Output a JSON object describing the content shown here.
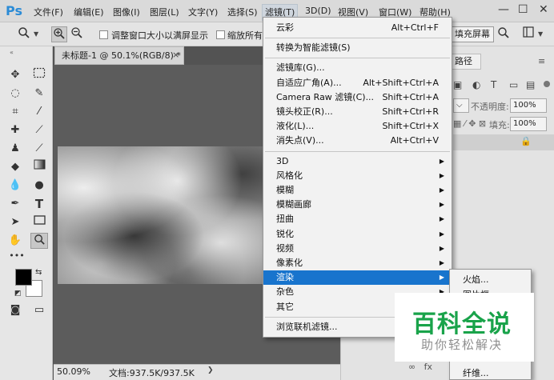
{
  "app": {
    "logo": "Ps"
  },
  "menubar": {
    "items": [
      "文件(F)",
      "编辑(E)",
      "图像(I)",
      "图层(L)",
      "文字(Y)",
      "选择(S)",
      "滤镜(T)",
      "3D(D)",
      "视图(V)",
      "窗口(W)",
      "帮助(H)"
    ],
    "active_index": 6,
    "window_controls": [
      "—",
      "☐",
      "✕"
    ]
  },
  "options": {
    "resize_windows_label": "调整窗口大小以满屏显示",
    "zoom_all_label": "缩放所有",
    "fill_screen_button": "填充屏幕"
  },
  "document": {
    "tab_title": "未标题-1 @ 50.1%(RGB/8) *",
    "close_glyph": "×",
    "zoom_level": "50.09%",
    "doc_size": "文档:937.5K/937.5K"
  },
  "right_panel": {
    "tab_path": "路径",
    "opacity_label": "不透明度:",
    "opacity_value": "100%",
    "fill_label": "填充:",
    "fill_value": "100%"
  },
  "filter_menu": {
    "items": [
      {
        "label": "云彩",
        "shortcut": "Alt+Ctrl+F"
      },
      {
        "sep": true
      },
      {
        "label": "转换为智能滤镜(S)"
      },
      {
        "sep": true
      },
      {
        "label": "滤镜库(G)..."
      },
      {
        "label": "自适应广角(A)...",
        "shortcut": "Alt+Shift+Ctrl+A"
      },
      {
        "label": "Camera Raw 滤镜(C)...",
        "shortcut": "Shift+Ctrl+A"
      },
      {
        "label": "镜头校正(R)...",
        "shortcut": "Shift+Ctrl+R"
      },
      {
        "label": "液化(L)...",
        "shortcut": "Shift+Ctrl+X"
      },
      {
        "label": "消失点(V)...",
        "shortcut": "Alt+Ctrl+V"
      },
      {
        "sep": true
      },
      {
        "label": "3D",
        "submenu": true
      },
      {
        "label": "风格化",
        "submenu": true
      },
      {
        "label": "模糊",
        "submenu": true
      },
      {
        "label": "模糊画廊",
        "submenu": true
      },
      {
        "label": "扭曲",
        "submenu": true
      },
      {
        "label": "锐化",
        "submenu": true
      },
      {
        "label": "视频",
        "submenu": true
      },
      {
        "label": "像素化",
        "submenu": true
      },
      {
        "label": "渲染",
        "submenu": true,
        "highlighted": true
      },
      {
        "label": "杂色",
        "submenu": true
      },
      {
        "label": "其它",
        "submenu": true
      },
      {
        "sep": true
      },
      {
        "label": "浏览联机滤镜..."
      }
    ]
  },
  "render_submenu": {
    "items": [
      "火焰...",
      "图片框...",
      "纤维..."
    ]
  },
  "watermark": {
    "title": "百科全说",
    "subtitle": "助你轻松解决"
  },
  "colors": {
    "highlight": "#1874cd",
    "workspace": "#535353",
    "watermark_green": "#19a34a"
  }
}
